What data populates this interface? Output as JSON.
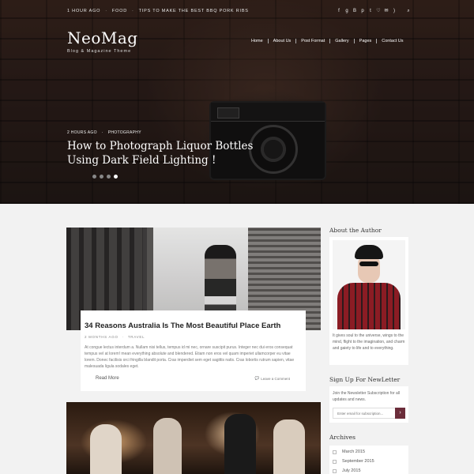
{
  "topbar": {
    "ticker": [
      "1 HOUR AGO",
      "FOOD",
      "TIPS TO MAKE THE BEST BBQ PORK RIBS"
    ],
    "social_icons": [
      "facebook-icon",
      "google-plus-icon",
      "behance-icon",
      "pinterest-icon",
      "twitter-icon",
      "heart-icon",
      "mail-icon",
      "rss-icon",
      "search-icon"
    ]
  },
  "logo": {
    "name": "NeoMag",
    "tagline": "Blog & Magazine Theme"
  },
  "nav": [
    "Home",
    "About Us",
    "Post Format",
    "Gallery",
    "Pages",
    "Contact Us"
  ],
  "hero": {
    "time": "2 HOURS AGO",
    "category": "PHOTOGRAPHY",
    "title": "How to Photograph Liquor Bottles Using Dark Field Lighting !",
    "slides": 4,
    "active_slide": 4
  },
  "post1": {
    "title": "34 Reasons Australia Is The Most Beautiful Place Earth",
    "time": "2 MONTHS AGO",
    "category": "TRAVEL",
    "excerpt": "At congue lectus interdum a. Nullam nisi tellus, tempus id mi nec, ornare suscipit purus. Integer nec dui eros consequat tempus vel at lorem! mean everything absolute and blendered. Etiam non eros vel quam imperiet ullamcorper eu vitae lorem. Donec facilisis orci fringilla blandit porta. Cras imperdiet sem eget sagittis natis. Cras lobortis rutrum sapien, vitae malesuada ligula sodales eget.",
    "read_more": "Read More",
    "comment": "Leave a Comment"
  },
  "sidebar": {
    "author_title": "About the Author",
    "author_text": "It gives soul to the universe, wings to the mind, flight to the imagination, and charm and gaiety to life and to everything.",
    "newsletter_title": "Sign Up For NewLetter",
    "newsletter_text": "Join the Newsletter Subscription for all updates and news.",
    "newsletter_placeholder": "Enter email for subscription...",
    "archives_title": "Archives",
    "archives": [
      "March 2015",
      "September 2015",
      "July 2015"
    ]
  }
}
